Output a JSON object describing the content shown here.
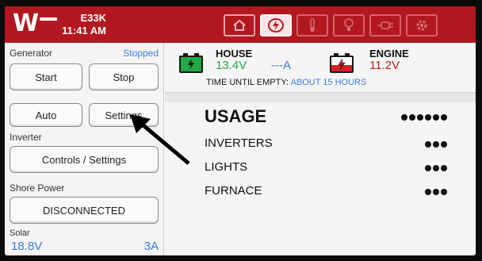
{
  "header": {
    "logo": "W",
    "unit_id": "E33K",
    "time": "11:41 AM"
  },
  "nav_tabs": [
    {
      "icon": "home-icon",
      "active": false
    },
    {
      "icon": "power-icon",
      "active": true
    },
    {
      "icon": "thermometer-icon",
      "active": false
    },
    {
      "icon": "light-bulb-icon",
      "active": false
    },
    {
      "icon": "plug-icon",
      "active": false
    },
    {
      "icon": "gear-icon",
      "active": false
    }
  ],
  "generator": {
    "label": "Generator",
    "status": "Stopped",
    "start_label": "Start",
    "stop_label": "Stop",
    "auto_label": "Auto",
    "settings_label": "Settings"
  },
  "inverter": {
    "label": "Inverter",
    "controls_label": "Controls / Settings"
  },
  "shore_power": {
    "label": "Shore Power",
    "status_label": "DISCONNECTED"
  },
  "solar": {
    "label": "Solar",
    "voltage": "18.8V",
    "current": "3A"
  },
  "house": {
    "label": "HOUSE",
    "voltage": "13.4V",
    "current": "---A"
  },
  "engine": {
    "label": "ENGINE",
    "voltage": "11.2V"
  },
  "time_until_empty": {
    "label": "TIME UNTIL EMPTY:",
    "value": "ABOUT 15 HOURS"
  },
  "usage": {
    "title": "USAGE",
    "title_dots": 6,
    "items": [
      {
        "label": "INVERTERS",
        "dots": 3
      },
      {
        "label": "LIGHTS",
        "dots": 3
      },
      {
        "label": "FURNACE",
        "dots": 3
      }
    ]
  },
  "colors": {
    "header_red": "#b3171f",
    "status_blue": "#3a7de0",
    "house_green": "#26a842",
    "engine_red": "#c2151d"
  }
}
